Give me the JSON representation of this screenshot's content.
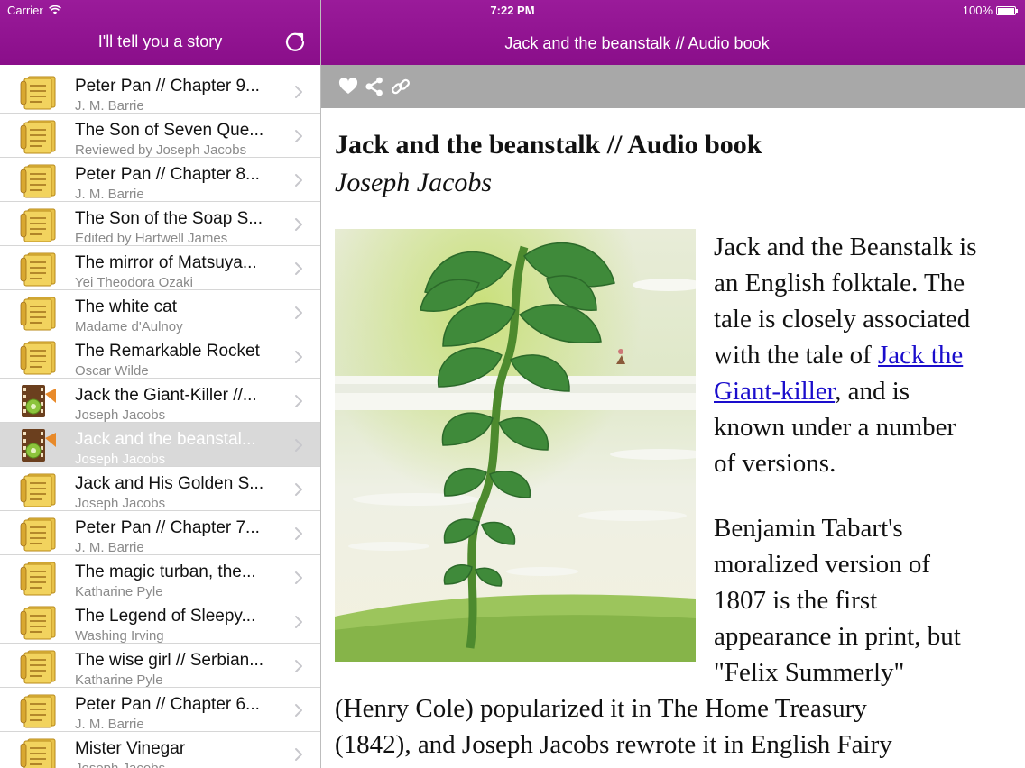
{
  "status_bar": {
    "carrier": "Carrier",
    "time": "7:22 PM",
    "battery": "100%"
  },
  "left_nav": {
    "title": "I'll tell you a story"
  },
  "stories": [
    {
      "title": "Peter Pan // Chapter 9...",
      "subtitle": "J. M. Barrie",
      "icon": "document-icon"
    },
    {
      "title": "The Son of Seven Que...",
      "subtitle": "Reviewed by Joseph Jacobs",
      "icon": "document-icon"
    },
    {
      "title": "Peter Pan // Chapter 8...",
      "subtitle": "J. M. Barrie",
      "icon": "document-icon"
    },
    {
      "title": "The Son of the Soap S...",
      "subtitle": "Edited by Hartwell James",
      "icon": "document-icon"
    },
    {
      "title": "The mirror of Matsuya...",
      "subtitle": "Yei Theodora Ozaki",
      "icon": "document-icon"
    },
    {
      "title": "The white cat",
      "subtitle": "Madame d'Aulnoy",
      "icon": "document-icon"
    },
    {
      "title": "The Remarkable Rocket",
      "subtitle": "Oscar Wilde",
      "icon": "document-icon"
    },
    {
      "title": "Jack the Giant-Killer //...",
      "subtitle": "Joseph Jacobs",
      "icon": "audio-film-icon"
    },
    {
      "title": "Jack and the beanstal...",
      "subtitle": "Joseph Jacobs",
      "icon": "audio-film-icon",
      "selected": true
    },
    {
      "title": "Jack and His Golden S...",
      "subtitle": "Joseph Jacobs",
      "icon": "document-icon"
    },
    {
      "title": "Peter Pan // Chapter 7...",
      "subtitle": "J. M. Barrie",
      "icon": "document-icon"
    },
    {
      "title": "The magic turban, the...",
      "subtitle": "Katharine Pyle",
      "icon": "document-icon"
    },
    {
      "title": "The Legend of Sleepy...",
      "subtitle": "Washing Irving",
      "icon": "document-icon"
    },
    {
      "title": "The wise girl // Serbian...",
      "subtitle": "Katharine Pyle",
      "icon": "document-icon"
    },
    {
      "title": "Peter Pan // Chapter 6...",
      "subtitle": "J. M. Barrie",
      "icon": "document-icon"
    },
    {
      "title": "Mister Vinegar",
      "subtitle": "Joseph Jacobs",
      "icon": "document-icon"
    }
  ],
  "right_nav": {
    "title": "Jack and the beanstalk // Audio book"
  },
  "toolbar": {
    "icons": [
      "heart-icon",
      "share-icon",
      "link-icon"
    ]
  },
  "article": {
    "title": "Jack and the beanstalk // Audio book",
    "author": "Joseph Jacobs",
    "p1_lines": [
      "Jack and the Beanstalk is",
      "an English folktale. The",
      "tale is closely associated"
    ],
    "p1_link_pre": "with the tale of ",
    "p1_link_a": "Jack the",
    "p1_link_b": "Giant-killer",
    "p1_after_link": ", and is",
    "p1_tail": [
      "known under a number",
      "of versions."
    ],
    "p2_lines": [
      "Benjamin Tabart's",
      "moralized version of",
      "1807 is the first",
      "appearance in print, but",
      "\"Felix Summerly\""
    ],
    "p2_full_lines": [
      "(Henry Cole) popularized it in The Home Treasury",
      "(1842), and Joseph Jacobs rewrote it in English Fairy"
    ]
  },
  "colors": {
    "nav_purple": "#92139a",
    "toolbar_gray": "#a8a8a8",
    "link_blue": "#1a0dcc",
    "selected_row": "#d9d9d9"
  }
}
